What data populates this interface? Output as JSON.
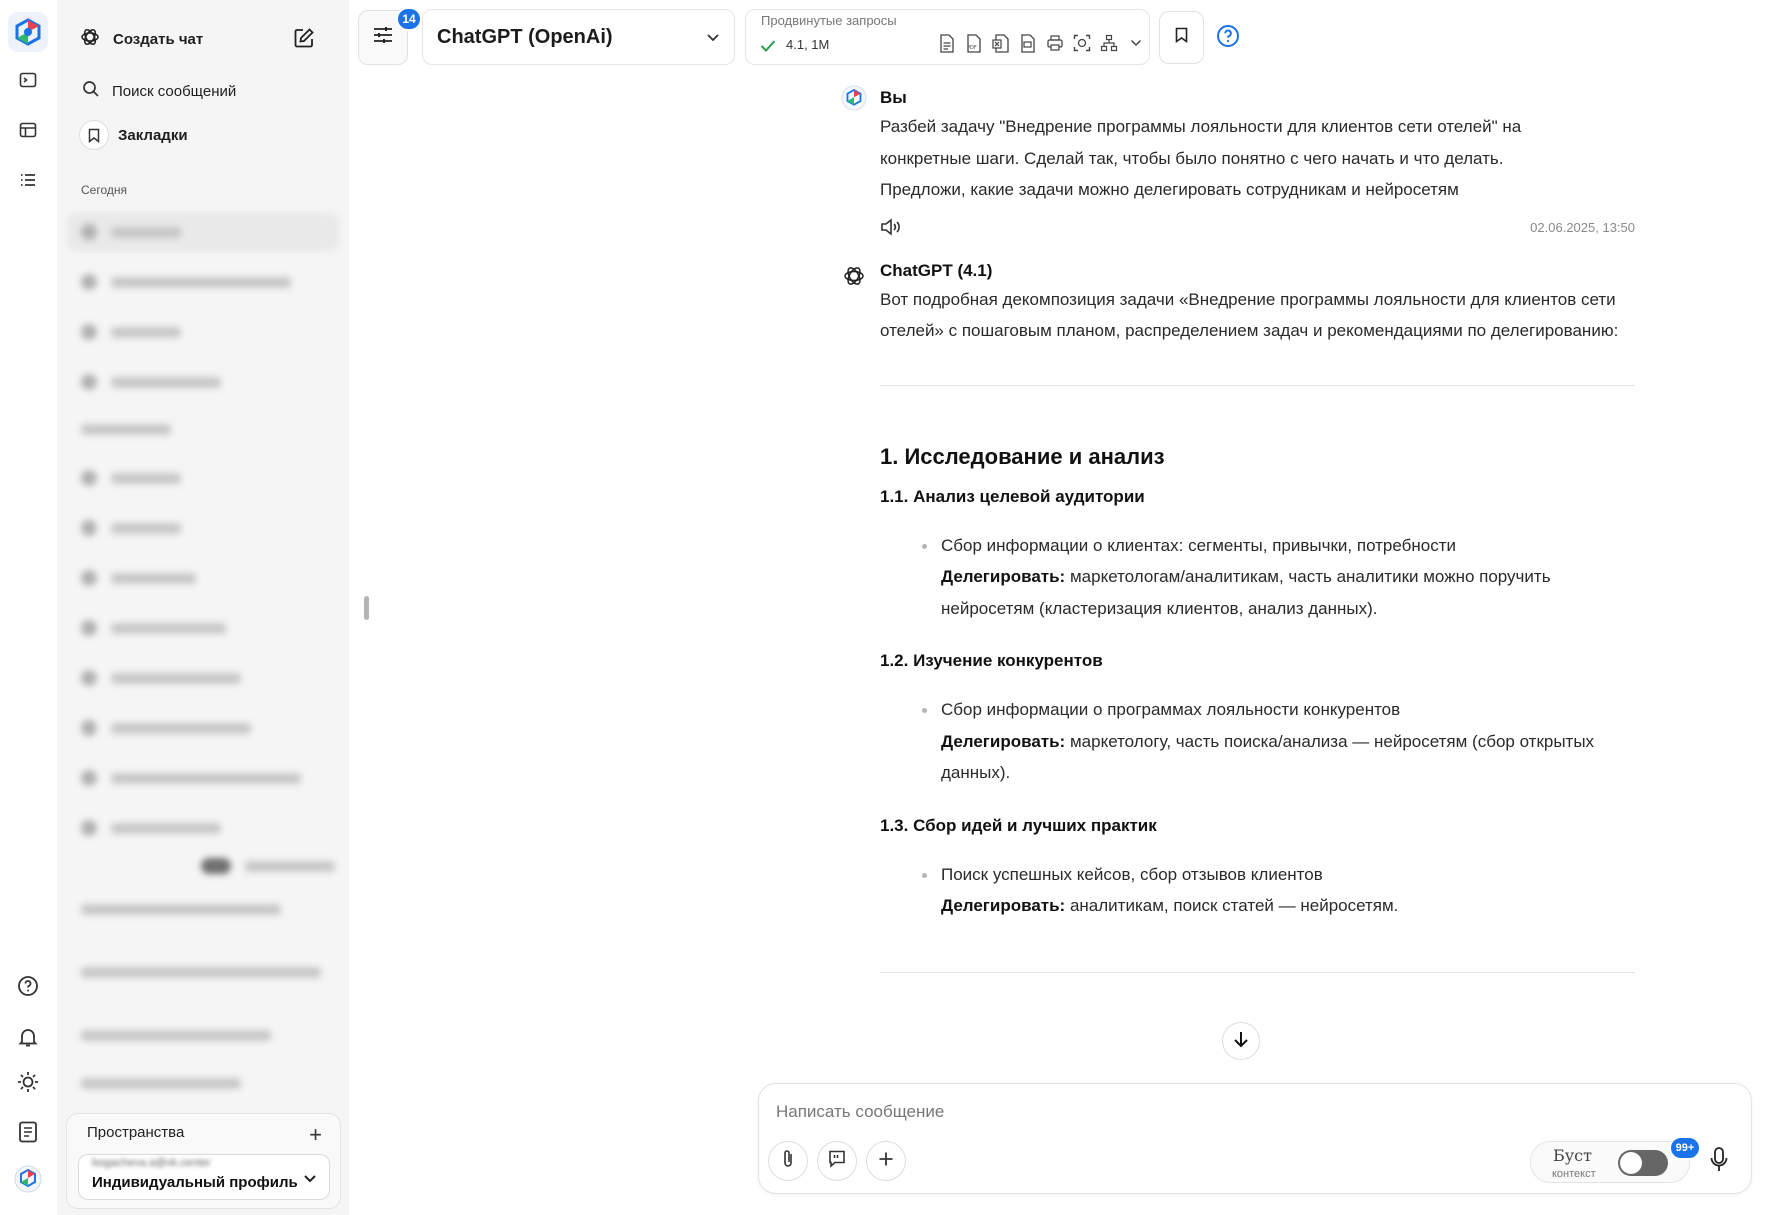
{
  "sidebar": {
    "new_chat_label": "Создать чат",
    "search_label": "Поиск сообщений",
    "bookmarks_label": "Закладки",
    "section_today": "Сегодня",
    "spaces_title": "Пространства",
    "profile_email": "bogacheva.a@vk.center",
    "profile_name": "Индивидуальный профиль"
  },
  "topbar": {
    "settings_badge": "14",
    "model_name": "ChatGPT (OpenAi)",
    "advanced_caption": "Продвинутые запросы",
    "advanced_value": "4.1, 1M"
  },
  "chat": {
    "user": {
      "author": "Вы",
      "text": "Разбей задачу \"Внедрение программы лояльности для клиентов сети отелей\" на конкретные шаги. Сделай так, чтобы было понятно с чего начать и что делать. Предложи, какие задачи можно делегировать сотрудникам и нейросетям",
      "timestamp": "02.06.2025, 13:50"
    },
    "assistant": {
      "author": "ChatGPT (4.1)",
      "intro": "Вот подробная декомпозиция задачи «Внедрение программы лояльности для клиентов сети отелей» с пошаговым планом, распределением задач и рекомендациями по делегированию:",
      "section1": "1. Исследование и анализ",
      "delegate_label": "Делегировать:",
      "s11_title": "1.1. Анализ целевой аудитории",
      "s11_text": "Сбор информации о клиентах: сегменты, привычки, потребности",
      "s11_delegate": "маркетологам/аналитикам, часть аналитики можно поручить нейросетям (кластеризация клиентов, анализ данных).",
      "s12_title": "1.2. Изучение конкурентов",
      "s12_text": "Сбор информации о программах лояльности конкурентов",
      "s12_delegate": "маркетологу, часть поиска/анализа — нейросетям (сбор открытых данных).",
      "s13_title": "1.3. Сбор идей и лучших практик",
      "s13_text": "Поиск успешных кейсов, сбор отзывов клиентов",
      "s13_delegate": "аналитикам, поиск статей — нейросетям."
    }
  },
  "composer": {
    "placeholder": "Написать сообщение",
    "boost_label": "Буст",
    "boost_sub": "контекст",
    "boost_badge": "99+"
  },
  "colors": {
    "accent": "#1a73e8",
    "check": "#2e9e4f"
  }
}
